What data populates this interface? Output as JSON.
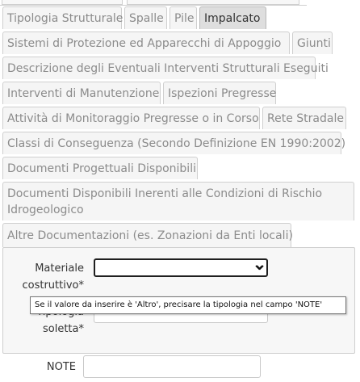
{
  "tabs": {
    "tipologia_strutturale": "Tipologia Strutturale",
    "spalle": "Spalle",
    "pile": "Pile",
    "impalcato": "Impalcato",
    "sistemi_protezione": "Sistemi di Protezione ed Apparecchi di Appoggio",
    "giunti": "Giunti",
    "descrizione_interventi": "Descrizione degli Eventuali Interventi Strutturali Eseguiti",
    "interventi_manutenzione": "Interventi di Manutenzione",
    "ispezioni_pregresse": "Ispezioni Pregresse",
    "attivita_monitoraggio": "Attività di Monitoraggio Pregresse o in Corso",
    "rete_stradale": "Rete Stradale",
    "classi_conseguenza": "Classi di Conseguenza (Secondo Definizione EN 1990:2002)",
    "documenti_progettuali": "Documenti Progettuali Disponibili",
    "documenti_idrogeologico": "Documenti Disponibili Inerenti alle Condizioni di Rischio Idrogeologico",
    "altre_documentazioni": "Altre Documentazioni (es. Zonazioni da Enti locali)"
  },
  "form": {
    "materiale_label_line1": "Materiale",
    "materiale_label_line2": "costruttivo*",
    "materiale_value": "",
    "tipologia_label_line1": "Tipologia",
    "tipologia_label_line2": "soletta*",
    "tipologia_value": "",
    "note_label": "NOTE",
    "note_value": ""
  },
  "tooltip": {
    "text": "Se il valore da inserire è 'Altro', precisare la tipologia nel campo 'NOTE'"
  },
  "colors": {
    "active_tab_bg": "#dedede",
    "tab_bg": "#f5f5f5",
    "panel_bg": "#f7f7f7",
    "border": "#cfcfcf"
  }
}
